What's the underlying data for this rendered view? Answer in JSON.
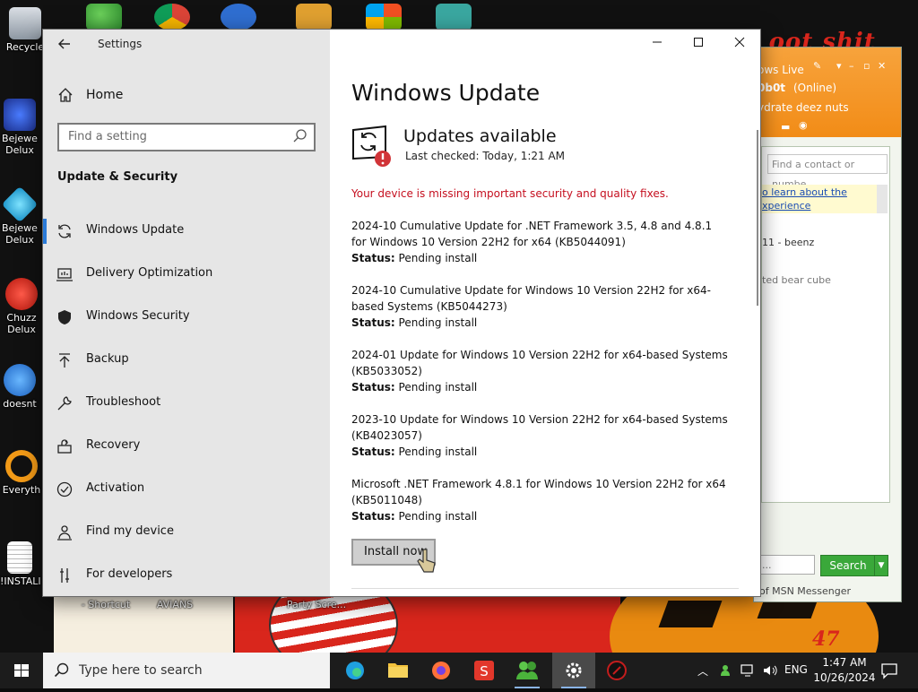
{
  "desktop": {
    "icons": [
      {
        "label": "Recycle"
      },
      {
        "label": "Bejewe Delux"
      },
      {
        "label": "Bejewe Delux"
      },
      {
        "label": "Chuzz Delux"
      },
      {
        "label": "doesnt"
      },
      {
        "label": "Everyth"
      },
      {
        "label": "!INSTALI"
      }
    ],
    "bottom_labels": [
      "- Shortcut",
      "AVIANS",
      "Party Scre..."
    ],
    "banner_text": "e oot shit",
    "bottom_banner": "47"
  },
  "msn": {
    "title": "ows Live",
    "user": "0b0t",
    "status": "(Online)",
    "psm": "ydrate deez nuts",
    "find_placeholder": "Find a contact or numbe",
    "link1": "o learn about the",
    "link2": "xperience",
    "entry1": "11 - beenz",
    "entry2": "ted bear cube",
    "search_placeholder": "...",
    "search_label": "Search",
    "footer": "of MSN Messenger"
  },
  "settings": {
    "window_title": "Settings",
    "home_label": "Home",
    "search_placeholder": "Find a setting",
    "section": "Update & Security",
    "nav": [
      {
        "label": "Windows Update",
        "icon": "sync-icon",
        "selected": true
      },
      {
        "label": "Delivery Optimization",
        "icon": "delivery-icon"
      },
      {
        "label": "Windows Security",
        "icon": "shield-icon"
      },
      {
        "label": "Backup",
        "icon": "backup-arrow-icon"
      },
      {
        "label": "Troubleshoot",
        "icon": "wrench-icon"
      },
      {
        "label": "Recovery",
        "icon": "recovery-icon"
      },
      {
        "label": "Activation",
        "icon": "check-circle-icon"
      },
      {
        "label": "Find my device",
        "icon": "person-pin-icon"
      },
      {
        "label": "For developers",
        "icon": "developer-icon"
      }
    ],
    "main": {
      "title": "Windows Update",
      "status_heading": "Updates available",
      "last_checked": "Last checked: Today, 1:21 AM",
      "warning": "Your device is missing important security and quality fixes.",
      "status_label": "Status:",
      "updates": [
        {
          "name": "2024-10 Cumulative Update for .NET Framework 3.5, 4.8 and 4.8.1 for Windows 10 Version 22H2 for x64 (KB5044091)",
          "status": "Pending install"
        },
        {
          "name": "2024-10 Cumulative Update for Windows 10 Version 22H2 for x64-based Systems (KB5044273)",
          "status": "Pending install"
        },
        {
          "name": "2024-01 Update for Windows 10 Version 22H2 for x64-based Systems (KB5033052)",
          "status": "Pending install"
        },
        {
          "name": "2023-10 Update for Windows 10 Version 22H2 for x64-based Systems (KB4023057)",
          "status": "Pending install"
        },
        {
          "name": "Microsoft .NET Framework 4.8.1 for Windows 10 Version 22H2 for x64 (KB5011048)",
          "status": "Pending install"
        }
      ],
      "install_button": "Install now"
    }
  },
  "taskbar": {
    "search_placeholder": "Type here to search",
    "language": "ENG",
    "time": "1:47 AM",
    "date": "10/26/2024"
  },
  "colors": {
    "accent": "#2b7bd9",
    "warning": "#c50f1f",
    "msn_orange": "#f28c17"
  }
}
